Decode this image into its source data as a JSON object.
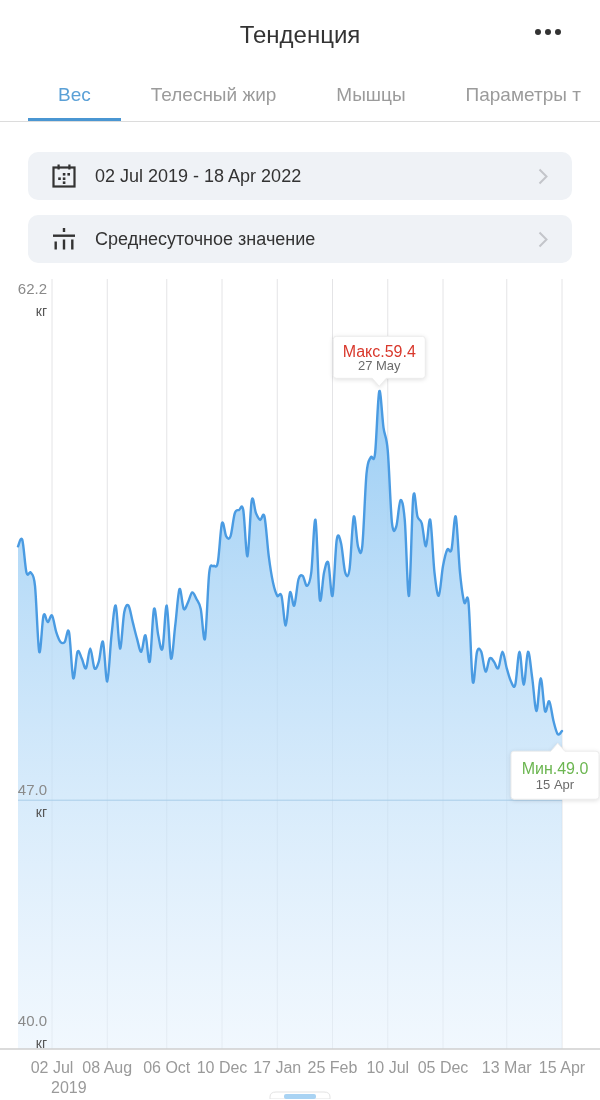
{
  "header": {
    "title": "Тенденция"
  },
  "tabs": [
    {
      "label": "Вес",
      "selected": true
    },
    {
      "label": "Телесный жир",
      "selected": false
    },
    {
      "label": "Мышцы",
      "selected": false
    },
    {
      "label": "Параметры т",
      "selected": false
    }
  ],
  "filters": [
    {
      "kind": "date_range",
      "value": "02 Jul 2019 - 18 Apr 2022"
    },
    {
      "kind": "aggregation",
      "value": "Среднесуточное значение"
    }
  ],
  "chart": {
    "chart_data": {
      "type": "area",
      "ylim": [
        40,
        62.2
      ],
      "yticks": [
        {
          "value": 62.2,
          "label": "62.2\nкг"
        },
        {
          "value": 47,
          "label": "47.0\nкг"
        },
        {
          "value": 40,
          "label": "40.0\nкг"
        }
      ],
      "ref_lines": [
        {
          "axis": "y",
          "value": 47
        }
      ],
      "categories": [
        null,
        null,
        null,
        null,
        null,
        null,
        null,
        null,
        "02 Jul\n2019",
        null,
        null,
        null,
        null,
        null,
        null,
        null,
        null,
        null,
        null,
        null,
        null,
        "08 Aug",
        null,
        null,
        null,
        null,
        null,
        null,
        null,
        null,
        null,
        null,
        null,
        null,
        null,
        "06 Oct",
        null,
        null,
        null,
        null,
        null,
        null,
        null,
        null,
        null,
        null,
        null,
        null,
        "10 Dec",
        null,
        null,
        null,
        null,
        null,
        null,
        null,
        null,
        null,
        null,
        null,
        null,
        "17 Jan",
        null,
        null,
        null,
        null,
        null,
        null,
        null,
        null,
        null,
        null,
        null,
        null,
        "25 Feb",
        null,
        null,
        null,
        null,
        null,
        null,
        null,
        null,
        null,
        null,
        null,
        null,
        "10 Jul",
        null,
        null,
        null,
        null,
        null,
        null,
        null,
        null,
        null,
        null,
        null,
        null,
        "05 Dec",
        null,
        null,
        null,
        null,
        null,
        null,
        null,
        null,
        null,
        null,
        null,
        null,
        null,
        null,
        "13 Mar",
        null,
        null,
        null,
        null,
        null,
        null,
        null,
        null,
        null,
        null,
        null,
        null,
        "15 Apr"
      ],
      "series": [
        {
          "color": "#4a9be2",
          "values": [
            54.7,
            54.9,
            53.9,
            53.9,
            53.5,
            51.5,
            52.6,
            52.4,
            52.6,
            52.1,
            51.8,
            51.8,
            52.1,
            50.7,
            51.5,
            51.3,
            51.0,
            51.6,
            51.0,
            51.2,
            51.8,
            50.6,
            52.0,
            52.9,
            51.6,
            52.7,
            52.9,
            52.4,
            51.9,
            51.5,
            52.0,
            51.2,
            52.8,
            52.0,
            51.6,
            52.9,
            51.3,
            52.3,
            53.4,
            52.8,
            53.0,
            53.3,
            53.1,
            52.8,
            51.9,
            53.9,
            54.1,
            54.2,
            55.4,
            55.0,
            55.0,
            55.7,
            55.8,
            55.8,
            54.4,
            56.1,
            55.7,
            55.5,
            55.6,
            54.4,
            53.6,
            53.2,
            53.2,
            52.3,
            53.3,
            52.9,
            53.7,
            53.8,
            53.5,
            53.9,
            55.5,
            53.1,
            53.9,
            54.2,
            53.2,
            54.9,
            54.8,
            53.9,
            54.0,
            55.6,
            54.7,
            54.7,
            56.9,
            57.4,
            57.5,
            59.4,
            58.3,
            57.6,
            55.4,
            55.3,
            56.1,
            55.5,
            53.2,
            56.2,
            55.6,
            55.4,
            54.7,
            55.5,
            53.9,
            53.2,
            54.1,
            54.6,
            54.6,
            55.6,
            53.9,
            53.0,
            53.0,
            50.6,
            51.5,
            51.5,
            50.9,
            51.3,
            51.2,
            51.0,
            51.5,
            51.0,
            50.6,
            50.5,
            51.5,
            50.5,
            51.5,
            50.7,
            49.7,
            50.7,
            49.7,
            50.0,
            49.4,
            49.0,
            49.1
          ]
        }
      ],
      "annotations": [
        {
          "y": 59.4,
          "text": "Макс.59.4\n27 May"
        },
        {
          "y": 49.0,
          "text": "Мин.49.0\n15 Apr"
        }
      ]
    }
  }
}
